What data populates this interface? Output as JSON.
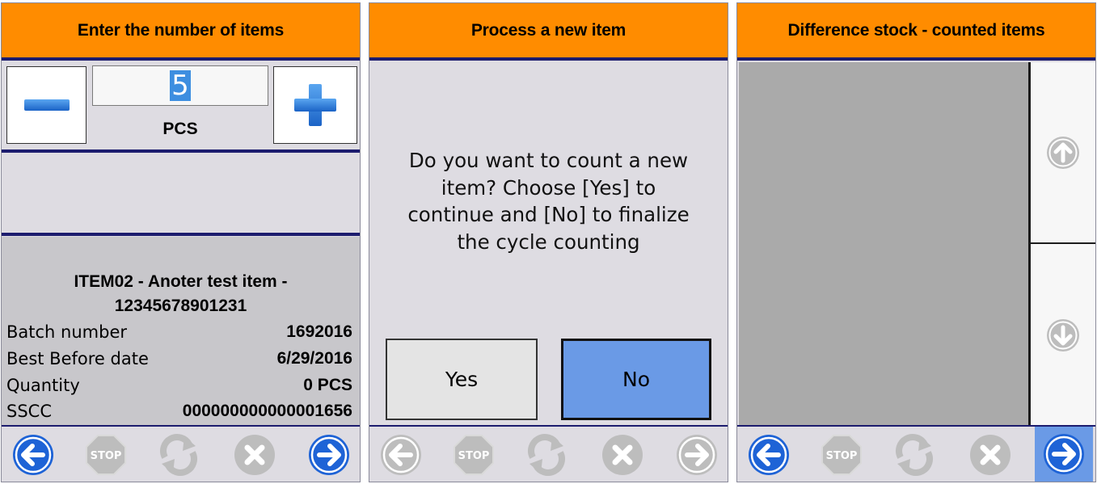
{
  "quantity_panel": {
    "title": "Enter the number of items",
    "quantity_value": "5",
    "unit": "PCS",
    "item_title_line1": "ITEM02 - Anoter test item -",
    "item_title_line2": "12345678901231",
    "details": [
      {
        "label": "Batch number",
        "value": "1692016"
      },
      {
        "label": "Best Before date",
        "value": "6/29/2016"
      },
      {
        "label": "Quantity",
        "value": "0 PCS"
      },
      {
        "label": "SSCC",
        "value": "000000000000001656"
      }
    ]
  },
  "process_panel": {
    "title": "Process a new item",
    "question_line1": "Do you want to count a new",
    "question_line2": "item? Choose [Yes] to",
    "question_line3": "continue and [No] to finalize",
    "question_line4": "the cycle counting",
    "yes_label": "Yes",
    "no_label": "No"
  },
  "difference_panel": {
    "title": "Difference stock - counted items"
  },
  "nav_icons": {
    "back": "back-arrow-icon",
    "stop": "stop-icon",
    "refresh": "refresh-icon",
    "cancel": "cancel-icon",
    "next": "next-arrow-icon",
    "stop_text": "STOP"
  },
  "colors": {
    "header": "#ff8c00",
    "panel_bg": "#dedce2",
    "accent_blue": "#6a9ae6",
    "active_icon": "#1e63d6",
    "disabled_icon": "#bdbdbd",
    "divider": "#1c1c6e"
  }
}
